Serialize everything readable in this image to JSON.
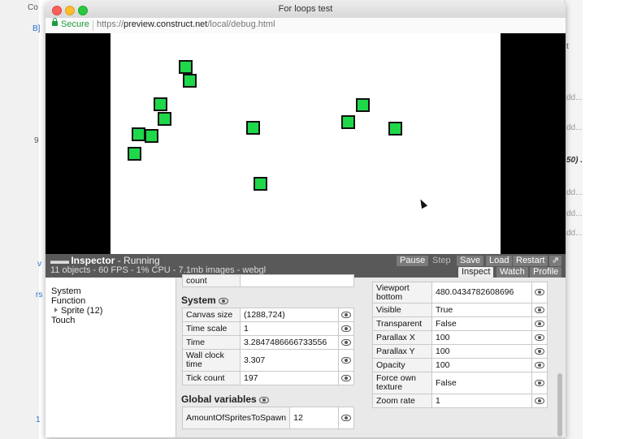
{
  "background": {
    "fragments": [
      "Co",
      "B]",
      "9",
      "v",
      "rs",
      "1",
      "t",
      "dd...",
      "50) .",
      "dd...",
      "dd...",
      "dd...",
      "dd..."
    ]
  },
  "window": {
    "title": "For loops test",
    "secure_label": "Secure",
    "url_scheme": "https://",
    "url_host": "preview.construct.net",
    "url_path": "/local/debug.html"
  },
  "inspector": {
    "title": "Inspector",
    "status": " - Running",
    "stats": "11 objects - 60 FPS - 1% CPU - 7.1mb images - webgl",
    "buttons": {
      "pause": "Pause",
      "step": "Step",
      "save": "Save",
      "load": "Load",
      "restart": "Restart",
      "popout": "⇗"
    },
    "tabs": {
      "inspect": "Inspect",
      "watch": "Watch",
      "profile": "Profile"
    },
    "tree": {
      "system": "System",
      "function": "Function",
      "sprite": "Sprite (12)",
      "touch": "Touch"
    },
    "partial_row_label": "count",
    "system_section": {
      "title": "System",
      "rows": [
        {
          "label": "Canvas size",
          "value": "(1288,724)"
        },
        {
          "label": "Time scale",
          "value": "1"
        },
        {
          "label": "Time",
          "value": "3.2847486666733556"
        },
        {
          "label": "Wall clock time",
          "value": "3.307"
        },
        {
          "label": "Tick count",
          "value": "197"
        }
      ]
    },
    "global_section": {
      "title": "Global variables",
      "rows": [
        {
          "label": "AmountOfSpritesToSpawn",
          "value": "12"
        }
      ]
    },
    "layer_props": [
      {
        "label": "Viewport bottom",
        "value": "480.0434782608696"
      },
      {
        "label": "Visible",
        "value": "True"
      },
      {
        "label": "Transparent",
        "value": "False"
      },
      {
        "label": "Parallax X",
        "value": "100"
      },
      {
        "label": "Parallax Y",
        "value": "100"
      },
      {
        "label": "Opacity",
        "value": "100"
      },
      {
        "label": "Force own texture",
        "value": "False"
      },
      {
        "label": "Zoom rate",
        "value": "1"
      }
    ]
  },
  "colors": {
    "sprite_fill": "#1ed84a",
    "inspector_bar": "#595959"
  }
}
